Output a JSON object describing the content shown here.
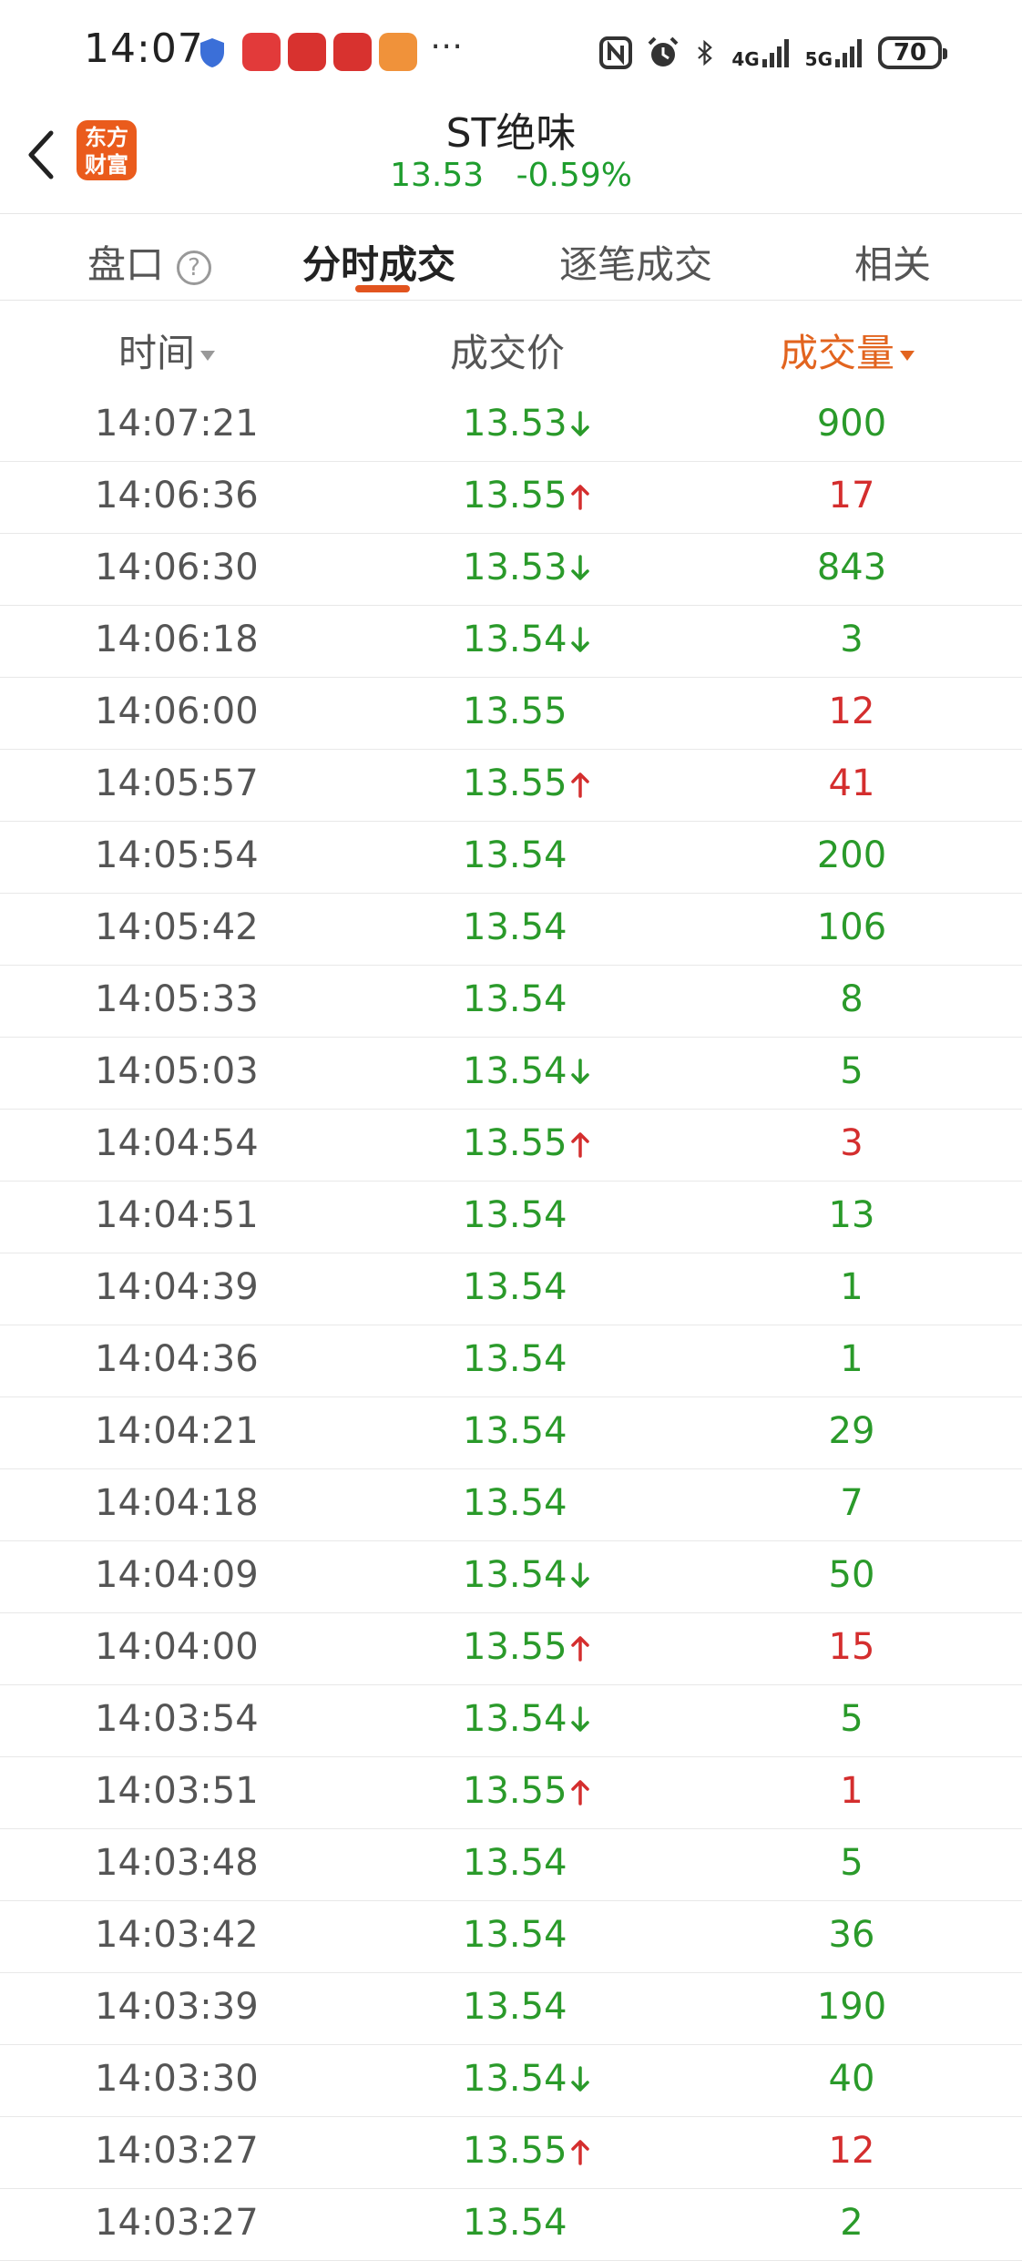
{
  "status_bar": {
    "time": "14:07",
    "net_4g": "4G",
    "net_5g": "5G",
    "battery": "70"
  },
  "header": {
    "logo_line1": "东方",
    "logo_line2": "财富",
    "title": "ST绝味",
    "price": "13.53",
    "change_pct": "-0.59%"
  },
  "tabs": [
    {
      "label": "盘口"
    },
    {
      "label": "分时成交"
    },
    {
      "label": "逐笔成交"
    },
    {
      "label": "相关"
    }
  ],
  "columns": {
    "time": "时间",
    "price": "成交价",
    "volume": "成交量"
  },
  "colors": {
    "up": "#d42e2e",
    "down": "#2a9a2a",
    "accent": "#e2541f"
  },
  "trades": [
    {
      "time": "14:07:21",
      "price": "13.53",
      "dir": "down",
      "volume": "900",
      "vol_color": "down"
    },
    {
      "time": "14:06:36",
      "price": "13.55",
      "dir": "up",
      "volume": "17",
      "vol_color": "up"
    },
    {
      "time": "14:06:30",
      "price": "13.53",
      "dir": "down",
      "volume": "843",
      "vol_color": "down"
    },
    {
      "time": "14:06:18",
      "price": "13.54",
      "dir": "down",
      "volume": "3",
      "vol_color": "down"
    },
    {
      "time": "14:06:00",
      "price": "13.55",
      "dir": "",
      "volume": "12",
      "vol_color": "up"
    },
    {
      "time": "14:05:57",
      "price": "13.55",
      "dir": "up",
      "volume": "41",
      "vol_color": "up"
    },
    {
      "time": "14:05:54",
      "price": "13.54",
      "dir": "",
      "volume": "200",
      "vol_color": "down"
    },
    {
      "time": "14:05:42",
      "price": "13.54",
      "dir": "",
      "volume": "106",
      "vol_color": "down"
    },
    {
      "time": "14:05:33",
      "price": "13.54",
      "dir": "",
      "volume": "8",
      "vol_color": "down"
    },
    {
      "time": "14:05:03",
      "price": "13.54",
      "dir": "down",
      "volume": "5",
      "vol_color": "down"
    },
    {
      "time": "14:04:54",
      "price": "13.55",
      "dir": "up",
      "volume": "3",
      "vol_color": "up"
    },
    {
      "time": "14:04:51",
      "price": "13.54",
      "dir": "",
      "volume": "13",
      "vol_color": "down"
    },
    {
      "time": "14:04:39",
      "price": "13.54",
      "dir": "",
      "volume": "1",
      "vol_color": "down"
    },
    {
      "time": "14:04:36",
      "price": "13.54",
      "dir": "",
      "volume": "1",
      "vol_color": "down"
    },
    {
      "time": "14:04:21",
      "price": "13.54",
      "dir": "",
      "volume": "29",
      "vol_color": "down"
    },
    {
      "time": "14:04:18",
      "price": "13.54",
      "dir": "",
      "volume": "7",
      "vol_color": "down"
    },
    {
      "time": "14:04:09",
      "price": "13.54",
      "dir": "down",
      "volume": "50",
      "vol_color": "down"
    },
    {
      "time": "14:04:00",
      "price": "13.55",
      "dir": "up",
      "volume": "15",
      "vol_color": "up"
    },
    {
      "time": "14:03:54",
      "price": "13.54",
      "dir": "down",
      "volume": "5",
      "vol_color": "down"
    },
    {
      "time": "14:03:51",
      "price": "13.55",
      "dir": "up",
      "volume": "1",
      "vol_color": "up"
    },
    {
      "time": "14:03:48",
      "price": "13.54",
      "dir": "",
      "volume": "5",
      "vol_color": "down"
    },
    {
      "time": "14:03:42",
      "price": "13.54",
      "dir": "",
      "volume": "36",
      "vol_color": "down"
    },
    {
      "time": "14:03:39",
      "price": "13.54",
      "dir": "",
      "volume": "190",
      "vol_color": "down"
    },
    {
      "time": "14:03:30",
      "price": "13.54",
      "dir": "down",
      "volume": "40",
      "vol_color": "down"
    },
    {
      "time": "14:03:27",
      "price": "13.55",
      "dir": "up",
      "volume": "12",
      "vol_color": "up"
    },
    {
      "time": "14:03:27",
      "price": "13.54",
      "dir": "",
      "volume": "2",
      "vol_color": "down"
    }
  ]
}
